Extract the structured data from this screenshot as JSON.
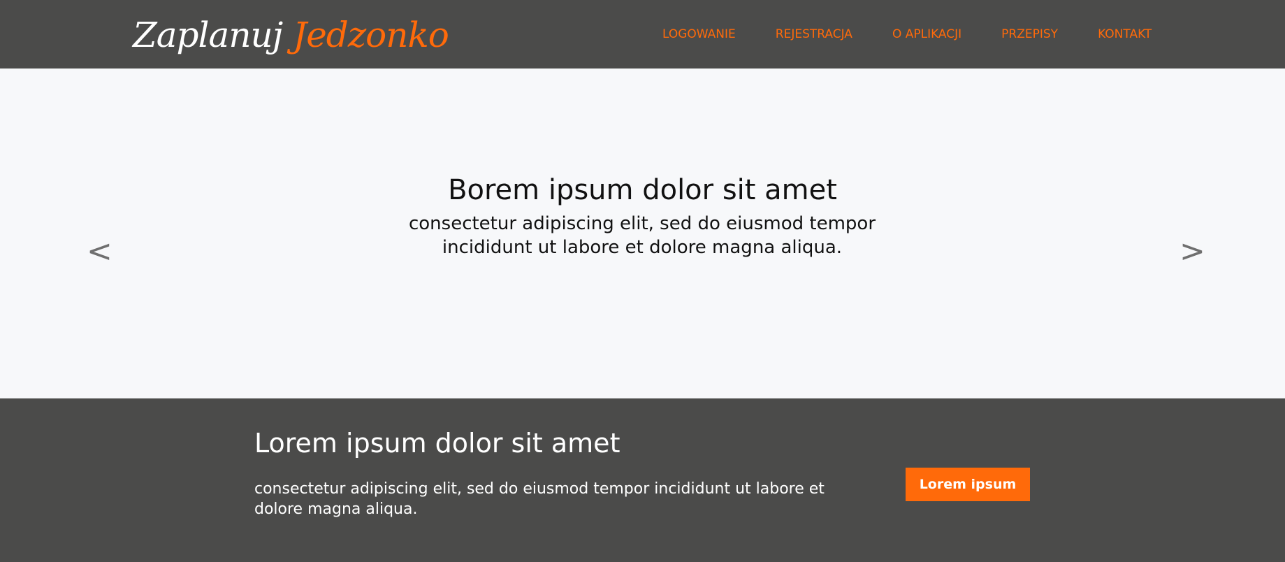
{
  "header": {
    "logo": {
      "part1": "Zaplanuj",
      "part2": "Jedzonko"
    },
    "nav": [
      {
        "label": "LOGOWANIE"
      },
      {
        "label": "REJESTRACJA"
      },
      {
        "label": "O APLIKACJI"
      },
      {
        "label": "PRZEPISY"
      },
      {
        "label": "KONTAKT"
      }
    ]
  },
  "hero": {
    "prev_arrow": "<",
    "next_arrow": ">",
    "title": "Borem ipsum dolor sit amet",
    "text": "consectetur adipiscing elit, sed do eiusmod tempor incididunt ut labore et dolore magna aliqua."
  },
  "cta": {
    "title": "Lorem ipsum dolor sit amet",
    "text": "consectetur adipiscing elit, sed do eiusmod tempor incididunt ut labore et dolore magna aliqua.",
    "button_label": "Lorem ipsum"
  },
  "colors": {
    "header_bg": "#4b4b4a",
    "accent": "#ff6a0a",
    "hero_bg": "#f7f8fa",
    "text_dark": "#111111",
    "arrow": "#6f6f6f"
  }
}
